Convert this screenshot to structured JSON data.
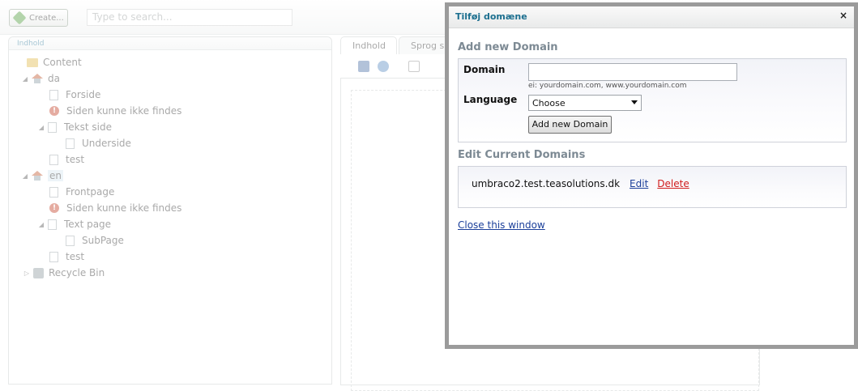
{
  "topbar": {
    "create_label": "Create...",
    "search_placeholder": "Type to search..."
  },
  "tree": {
    "header": "Indhold",
    "nodes": [
      {
        "label": "Content"
      },
      {
        "label": "da"
      },
      {
        "label": "Forside"
      },
      {
        "label": "Siden kunne ikke findes"
      },
      {
        "label": "Tekst side"
      },
      {
        "label": "Underside"
      },
      {
        "label": "test"
      },
      {
        "label": "en"
      },
      {
        "label": "Frontpage"
      },
      {
        "label": "Siden kunne ikke findes"
      },
      {
        "label": "Text page"
      },
      {
        "label": "SubPage"
      },
      {
        "label": "test"
      },
      {
        "label": "Recycle Bin"
      }
    ]
  },
  "content_tabs": [
    {
      "label": "Indhold"
    },
    {
      "label": "Sprog sp"
    }
  ],
  "modal": {
    "title": "Tilføj domæne",
    "close_glyph": "×",
    "add_section_title": "Add new Domain",
    "domain_label": "Domain",
    "domain_value": "",
    "domain_hint": "ei: yourdomain.com, www.yourdomain.com",
    "language_label": "Language",
    "language_selected": "Choose",
    "add_button_label": "Add new Domain",
    "edit_section_title": "Edit Current Domains",
    "domains": [
      {
        "name": "umbraco2.test.teasolutions.dk",
        "edit_label": "Edit",
        "delete_label": "Delete"
      }
    ],
    "close_window_label": "Close this window"
  },
  "colors": {
    "title_teal": "#1c6f8f",
    "link_blue": "#1b3f9a",
    "delete_red": "#d01c1c",
    "section_gray": "#7d8a94"
  }
}
